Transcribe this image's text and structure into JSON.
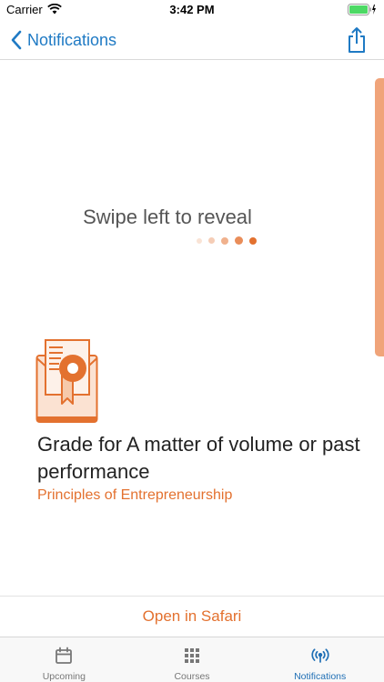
{
  "status_bar": {
    "carrier": "Carrier",
    "time": "3:42 PM"
  },
  "nav": {
    "back_label": "Notifications",
    "share_icon": "share-icon"
  },
  "swipe_hint": "Swipe left to reveal",
  "notification": {
    "icon": "certificate-icon",
    "title": "Grade for A matter of volume or past performance",
    "course": "Principles of Entrepreneurship"
  },
  "open_in_safari": "Open in Safari",
  "tabs": [
    {
      "label": "Upcoming",
      "icon": "calendar-icon",
      "active": false
    },
    {
      "label": "Courses",
      "icon": "grid-icon",
      "active": false
    },
    {
      "label": "Notifications",
      "icon": "broadcast-icon",
      "active": true
    }
  ],
  "colors": {
    "accent": "#e3712f",
    "link_blue": "#1f7ac4",
    "active_tab": "#1f6fb5",
    "scroll_indicator": "#f0a47a"
  }
}
